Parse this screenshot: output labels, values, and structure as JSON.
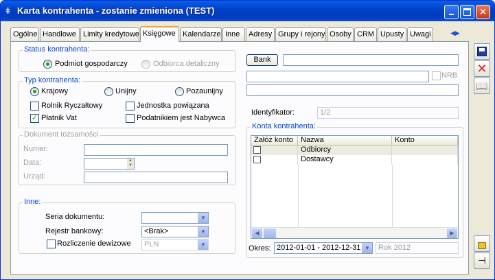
{
  "window": {
    "title": "Karta kontrahenta - zostanie zmieniona (TEST)"
  },
  "tabs": [
    {
      "label": "Ogólne"
    },
    {
      "label": "Handlowe"
    },
    {
      "label": "Limity kredytowe"
    },
    {
      "label": "Księgowe"
    },
    {
      "label": "Kalendarze"
    },
    {
      "label": "Inne"
    },
    {
      "label": "Adresy"
    },
    {
      "label": "Grupy i rejony"
    },
    {
      "label": "Osoby"
    },
    {
      "label": "CRM"
    },
    {
      "label": "Upusty"
    },
    {
      "label": "Uwagi"
    }
  ],
  "active_tab": "Księgowe",
  "status": {
    "title": "Status kontrahenta:",
    "opt1": "Podmiot gospodarczy",
    "opt2": "Odbiorca detaliczny"
  },
  "typ": {
    "title": "Typ kontrahenta:",
    "krajowy": "Krajowy",
    "unijny": "Unijny",
    "pozaunijny": "Pozaunijny",
    "rolnik": "Rolnik Ryczałtowy",
    "jednostka": "Jednostka powiązana",
    "platnik": "Płatnik Vat",
    "podatnik": "Podatnikiem jest Nabywca"
  },
  "dokument": {
    "title": "Dokument tożsamości",
    "numer": "Numer:",
    "data": "Data:",
    "urzad": "Urząd:"
  },
  "inne": {
    "title": "Inne:",
    "seria": "Seria dokumentu:",
    "rejestr": "Rejestr bankowy:",
    "rejestr_value": "<Brak>",
    "rozliczenie": "Rozliczenie dewizowe",
    "waluta": "PLN"
  },
  "bank": {
    "button": "Bank",
    "nrb": "NRB"
  },
  "identyfikator": {
    "label": "Identyfikator:",
    "value": "1/2"
  },
  "konta": {
    "title": "Konta kontrahenta:",
    "headers": [
      "Załóż konto",
      "Nazwa",
      "Konto"
    ],
    "rows": [
      {
        "nazwa": "Odbiorcy"
      },
      {
        "nazwa": "Dostawcy"
      }
    ]
  },
  "okres": {
    "label": "Okres:",
    "value": "2012-01-01 - 2012-12-31",
    "rok": "Rok 2012"
  }
}
